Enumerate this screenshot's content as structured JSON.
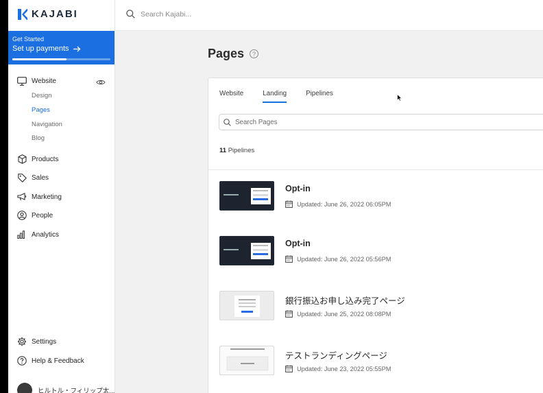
{
  "brand": {
    "name": "KAJABI"
  },
  "search": {
    "placeholder": "Search Kajabi..."
  },
  "get_started": {
    "title": "Get Started",
    "link": "Set up payments",
    "progress": 0.55
  },
  "sidebar": {
    "website": "Website",
    "sub": [
      "Design",
      "Pages",
      "Navigation",
      "Blog"
    ],
    "active_sub": "Pages",
    "items": [
      "Products",
      "Sales",
      "Marketing",
      "People",
      "Analytics"
    ],
    "settings": "Settings",
    "help": "Help & Feedback",
    "user": "ヒルトル・フィリップ太..."
  },
  "main": {
    "title": "Pages",
    "tabs": [
      "Website",
      "Landing",
      "Pipelines"
    ],
    "active_tab": "Landing",
    "search_placeholder": "Search Pages",
    "count_number": "11",
    "count_label": "Pipelines",
    "pages": [
      {
        "title": "Opt-in",
        "updated": "Updated: June 26, 2022 06:05PM",
        "thumb": "dark"
      },
      {
        "title": "Opt-in",
        "updated": "Updated: June 26, 2022 05:56PM",
        "thumb": "dark"
      },
      {
        "title": "銀行振込お申し込み完了ページ",
        "updated": "Updated: June 25, 2022 08:08PM",
        "thumb": "light"
      },
      {
        "title": "テストランディングページ",
        "updated": "Updated: June 23, 2022 05:55PM",
        "thumb": "white"
      }
    ]
  },
  "colors": {
    "accent": "#1b6fe0",
    "sidebar_bg": "#ffffff",
    "page_bg": "#f1f1f1"
  }
}
